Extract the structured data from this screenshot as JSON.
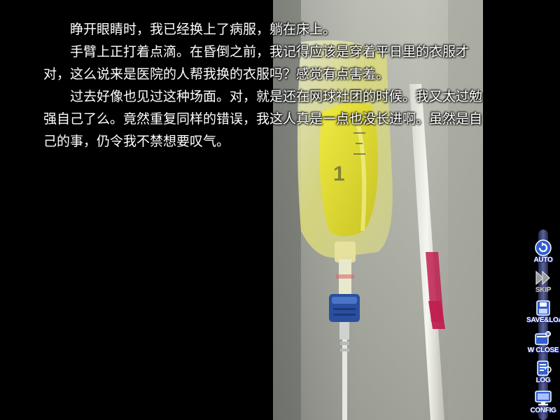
{
  "dialogue": {
    "paragraphs": [
      "睁开眼睛时，我已经换上了病服，躺在床上。",
      "手臂上正打着点滴。在昏倒之前，我记得应该是穿着平日里的衣服才对，这么说来是医院的人帮我换的衣服吗？感觉有点害羞。",
      "过去好像也见过这种场面。对，就是还在网球社团的时候。我又太过勉强自己了么。竟然重复同样的错误，我这人真是一点也没长进啊。虽然是自己的事，仍令我不禁想要叹气。"
    ]
  },
  "menu": {
    "auto": "AUTO",
    "skip": "SKIP",
    "save_load": "SAVE&LOAD",
    "w_close": "W CLOSE",
    "log": "LOG",
    "config": "CONFIG"
  },
  "cg": {
    "bag_marking": "1"
  },
  "colors": {
    "menu_blue": "#2f5fd0",
    "bag_yellow": "#e4e02a",
    "cap_blue": "#2a4fa0",
    "pole_red": "#c02050"
  },
  "icons": {
    "auto": "refresh-icon",
    "skip": "fast-forward-icon",
    "save_load": "floppy-disk-icon",
    "w_close": "window-close-icon",
    "log": "document-log-icon",
    "config": "monitor-config-icon"
  }
}
